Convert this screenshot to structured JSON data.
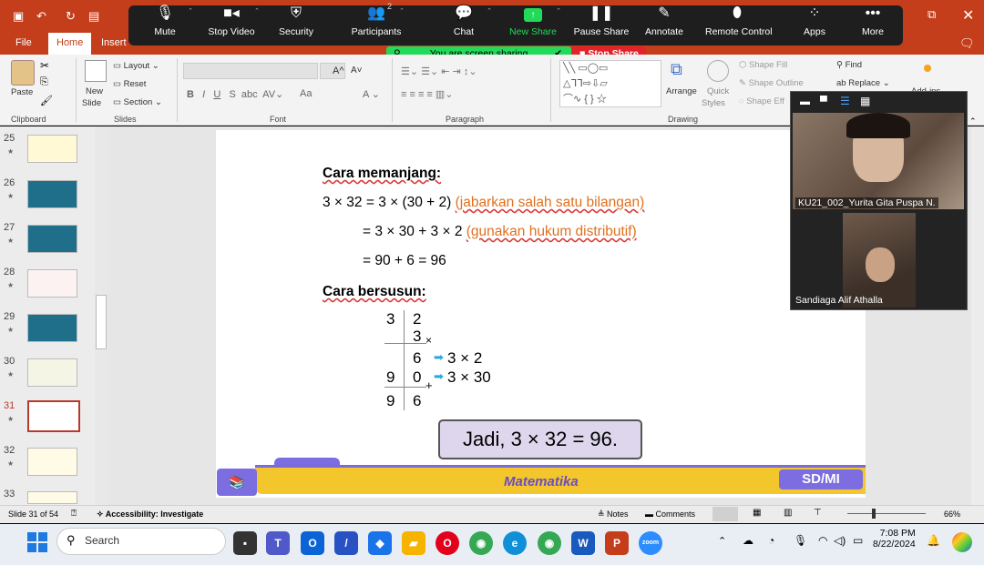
{
  "app": {
    "tabs": [
      "File",
      "Home",
      "Insert"
    ],
    "active_tab": "Home"
  },
  "zoom": {
    "buttons": [
      {
        "label": "Mute",
        "icon": "microphone-icon"
      },
      {
        "label": "Stop Video",
        "icon": "camera-icon"
      },
      {
        "label": "Security",
        "icon": "shield-icon"
      },
      {
        "label": "Participants",
        "icon": "participants-icon",
        "count": "2"
      },
      {
        "label": "Chat",
        "icon": "chat-icon"
      },
      {
        "label": "New Share",
        "icon": "share-screen-icon"
      },
      {
        "label": "Pause Share",
        "icon": "pause-icon"
      },
      {
        "label": "Annotate",
        "icon": "pen-icon"
      },
      {
        "label": "Remote Control",
        "icon": "mouse-icon"
      },
      {
        "label": "Apps",
        "icon": "apps-icon"
      },
      {
        "label": "More",
        "icon": "more-icon"
      }
    ],
    "sharing_text": "You are screen sharing",
    "stop_share": "Stop Share",
    "colors": {
      "new_share": "#23d959",
      "stop": "#e0242a"
    }
  },
  "ribbon": {
    "clipboard": {
      "paste": "Paste",
      "label": "Clipboard"
    },
    "slides": {
      "new_slide": "New",
      "new_slide2": "Slide",
      "layout": "Layout",
      "reset": "Reset",
      "section": "Section",
      "label": "Slides"
    },
    "font": {
      "label": "Font",
      "grow": "A^",
      "shrink": "A˅",
      "case": "Aa"
    },
    "paragraph": {
      "label": "Paragraph"
    },
    "drawing": {
      "label": "Drawing",
      "arrange": "Arrange",
      "quick_styles": "Quick",
      "quick_styles2": "Styles",
      "shape_fill": "Shape Fill",
      "shape_outline": "Shape Outline",
      "shape_effects": "Shape Eff"
    },
    "editing": {
      "find": "Find",
      "replace": "Replace",
      "addins": "Add-ins"
    }
  },
  "slides_panel": {
    "items": [
      {
        "num": "25"
      },
      {
        "num": "26"
      },
      {
        "num": "27"
      },
      {
        "num": "28"
      },
      {
        "num": "29"
      },
      {
        "num": "30"
      },
      {
        "num": "31",
        "selected": true
      },
      {
        "num": "32"
      },
      {
        "num": "33"
      }
    ]
  },
  "slide": {
    "heading1": "Cara memanjang:",
    "line1_main": "3 × 32 = 3 × (30 + 2) ",
    "line1_note": "(jabarkan salah satu bilangan)",
    "line2_main": "= 3 × 30 + 3 × 2 ",
    "line2_note": "(gunakan hukum distributif)",
    "line3": "= 90 + 6 = 96",
    "heading2": "Cara bersusun:",
    "column": {
      "r1": [
        "3",
        "2"
      ],
      "r2": "3",
      "times": "×",
      "r3": "6",
      "r3_note": "3 × 2",
      "r4": [
        "9",
        "0"
      ],
      "r4_note": "3 × 30",
      "plus": "+",
      "r5": [
        "9",
        "6"
      ]
    },
    "result": "Jadi, 3 × 32 = 96.",
    "footer_subject": "Matematika",
    "footer_level": "SD/MI"
  },
  "participants": [
    {
      "name": "KU21_002_Yurita Gita Puspa N."
    },
    {
      "name": "Sandiaga Alif Athalla"
    }
  ],
  "status": {
    "slide_info": "Slide 31 of 54",
    "accessibility": "Accessibility: Investigate",
    "notes": "Notes",
    "comments": "Comments",
    "zoom": "66%"
  },
  "taskbar": {
    "search": "Search",
    "time": "7:08 PM",
    "date": "8/22/2024"
  }
}
